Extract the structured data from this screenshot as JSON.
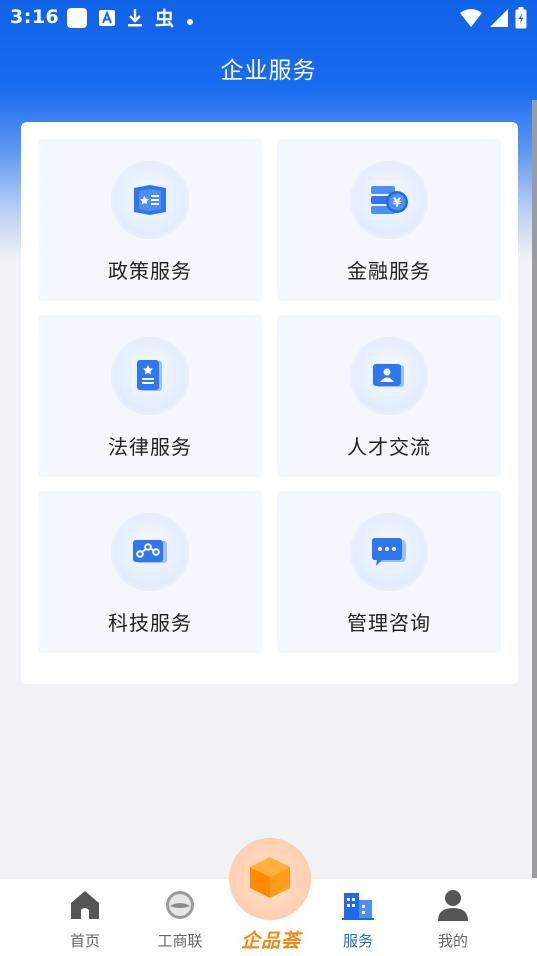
{
  "status_bar": {
    "time": "3:16",
    "left_icons": [
      "app-square-icon",
      "font-a-icon",
      "download-icon",
      "bug-icon",
      "dot-icon"
    ],
    "right_icons": [
      "wifi-icon",
      "signal-icon",
      "battery-charging-icon"
    ]
  },
  "header": {
    "title": "企业服务"
  },
  "services": [
    {
      "label": "政策服务",
      "icon": "policy-book-icon"
    },
    {
      "label": "金融服务",
      "icon": "finance-coin-icon"
    },
    {
      "label": "法律服务",
      "icon": "law-document-icon"
    },
    {
      "label": "人才交流",
      "icon": "talent-id-card-icon"
    },
    {
      "label": "科技服务",
      "icon": "tech-node-icon"
    },
    {
      "label": "管理咨询",
      "icon": "consult-chat-icon"
    }
  ],
  "bottom_nav": {
    "items": [
      {
        "label": "首页",
        "icon": "home-icon",
        "active": false
      },
      {
        "label": "工商联",
        "icon": "federation-logo-icon",
        "active": false
      },
      {
        "label": "服务",
        "icon": "building-icon",
        "active": true
      },
      {
        "label": "我的",
        "icon": "user-icon",
        "active": false
      }
    ],
    "center": {
      "icon": "cube-box-icon",
      "brand": "企品荟"
    }
  },
  "colors": {
    "primary": "#1a6cf0",
    "active_nav": "#1f6ae8",
    "brand_orange": "#f28a14",
    "tile_bg": "#f4f7fd"
  }
}
